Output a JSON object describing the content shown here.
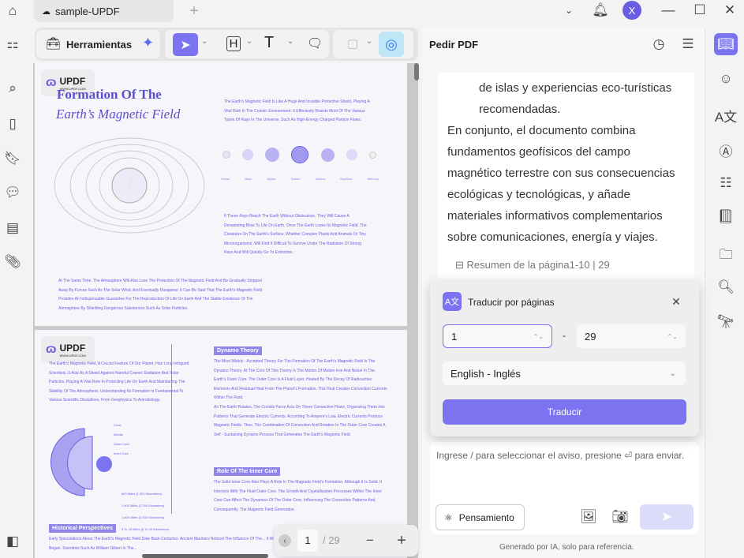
{
  "window": {
    "tab_title": "sample-UPDF",
    "new_tab": "+",
    "avatar": "X"
  },
  "toolbar": {
    "tools_label": "Herramientas"
  },
  "pdf": {
    "page1": {
      "logo": "UPDF",
      "logo_sub": "WWW.UPDF.COM",
      "title1": "Formation Of The",
      "title2": "Earth’s Magnetic Field",
      "p1": "The Earth's Magnetic Field Is Like A Huge And Invisible Protective Shield, Playing A Vital Role In The Cosmic Environment. It Effectively Resists Most Of The Various Types Of Rays In The Universe, Such As High-Energy Charged Particle Flows.",
      "planets": [
        "Venus",
        "Mars",
        "Jupiter",
        "Saturn",
        "Uranus",
        "Neptune",
        "Mercury"
      ],
      "p2": "If These Rays Reach The Earth Without Obstruction, They Will Cause A Devastating Blow To Life On Earth. Once The Earth Loses Its Magnetic Field, The Creatures On The Earth's Surface, Whether Complex Plants And Animals Or Tiny Microorganisms, Will Find It Difficult To Survive Under The Radiation Of Strong Rays And Will Quickly Go To Extinction.",
      "p3": "At The Same Time, The Atmosphere Will Also Lose The Protection Of The Magnetic Field And Be Gradually Stripped Away By Forces Such As The Solar Wind, And Eventually Disappear. It Can Be Said That The Earth's Magnetic Field Provides An Indispensable Guarantee For The Reproduction Of Life On Earth And The Stable Existence Of The Atmosphere By Shielding Dangerous Substances Such As Solar Particles."
    },
    "page2": {
      "p1": "The Earth's Magnetic Field, A Crucial Feature Of Our Planet, Has Long Intrigued Scientists. It Acts As A Shield Against Harmful Cosmic Radiation And Solar Particles, Playing A Vital Role In Protecting Life On Earth And Maintaining The Stability Of The Atmosphere. Understanding Its Formation Is Fundamental To Various Scientific Disciplines, From Geophysics To Astrobiology.",
      "h1": "Dynamo Theory",
      "d1": "The Most Widely - Accepted Theory For The Formation Of The Earth's Magnetic Field Is The Dynamo Theory. At The Core Of This Theory Is The Motion Of Molten Iron And Nickel In The Earth's Outer Core. The Outer Core Is A Fluid Layer, Heated By The Decay Of Radioactive Elements And Residual Heat From The Planet's Formation. This Heat Creates Convection Currents Within The Fluid.",
      "d2": "As The Earth Rotates, The Coriolis Force Acts On These Convective Flows, Organizing Them Into Patterns That Generate Electric Currents. According To Ampere's Law, Electric Currents Produce Magnetic Fields. Thus, The Combination Of Convection And Rotation In The Outer Core Creates A Self - Sustaining Dynamo Process That Generates The Earth's Magnetic Field.",
      "h2": "Role Of The Inner Core",
      "r1": "The Solid Inner Core Also Plays A Role In The Magnetic Field's Formation. Although It Is Solid, It Interacts With The Fluid Outer Core. The Growth And Crystallization Processes Within The Inner Core Can Affect The Dynamics Of The Outer Core, Influencing The Convective Patterns And, Consequently, The Magnetic Field Generation.",
      "h3": "Historical Perspectives",
      "hp": "Early Speculations About The Earth's Magnetic Field Date Back Centuries. Ancient Mariners Noticed The Influence Of The... It Was Not Until The Scientific Revolution That More Systematic Studies Began. Scientists Such As William Gilbert In The...",
      "layers": [
        "Crust",
        "Mantle",
        "Outer Core",
        "Inner Core"
      ],
      "depths": [
        "800 Miles (1,300 Kilometers)",
        "1,400 Miles (2,250 Kilometers)",
        "1,800 Miles (2,900 Kilometers)",
        "5 To 25 Miles (8 To 40 Kilometers)"
      ]
    }
  },
  "pager": {
    "current": "1",
    "total": "/ 29"
  },
  "ai": {
    "title": "Pedir PDF",
    "chat_lines": [
      "de islas y experiencias eco-turísticas recomendadas.",
      "En conjunto, el documento combina fundamentos geofísicos del campo magnético terrestre con sus consecuencias ecológicas y tecnológicas, y añade materiales informativos complementarios sobre comunicaciones, energía y viajes."
    ],
    "summary_ref": "Resumen de la página1-10 | 29",
    "popup": {
      "title": "Traducir por páginas",
      "from": "1",
      "dash": "-",
      "to": "29",
      "language": "English - Inglés",
      "button": "Traducir"
    },
    "input_placeholder": "Ingrese / para seleccionar el aviso, presione ⏎ para enviar.",
    "thinking": "Pensamiento",
    "footer": "Generado por IA, solo para referencia."
  },
  "colors": {
    "accent": "#7b73f0",
    "pdf_text": "#6a5ee0"
  }
}
